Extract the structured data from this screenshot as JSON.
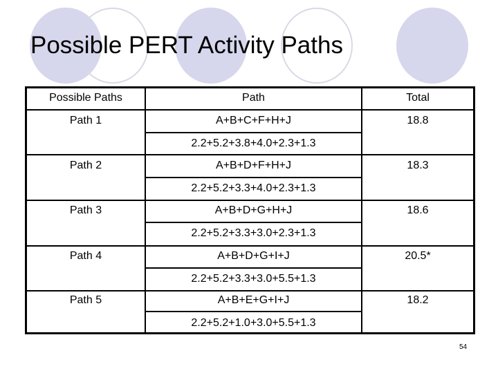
{
  "slide": {
    "title": "Possible PERT Activity Paths",
    "page_number": "54"
  },
  "table": {
    "headers": [
      "Possible Paths",
      "Path",
      "Total"
    ],
    "rows": [
      {
        "name": "Path 1",
        "activities": "A+B+C+F+H+J",
        "durations": "2.2+5.2+3.8+4.0+2.3+1.3",
        "total": "18.8"
      },
      {
        "name": "Path 2",
        "activities": "A+B+D+F+H+J",
        "durations": "2.2+5.2+3.3+4.0+2.3+1.3",
        "total": "18.3"
      },
      {
        "name": "Path 3",
        "activities": "A+B+D+G+H+J",
        "durations": "2.2+5.2+3.3+3.0+2.3+1.3",
        "total": "18.6"
      },
      {
        "name": "Path 4",
        "activities": "A+B+D+G+I+J",
        "durations": "2.2+5.2+3.3+3.0+5.5+1.3",
        "total": "20.5*"
      },
      {
        "name": "Path 5",
        "activities": "A+B+E+G+I+J",
        "durations": "2.2+5.2+1.0+3.0+5.5+1.3",
        "total": "18.2"
      }
    ]
  },
  "theme": {
    "circle_fill": "#d6d6ec",
    "circle_outline": "#d9d9e6"
  }
}
